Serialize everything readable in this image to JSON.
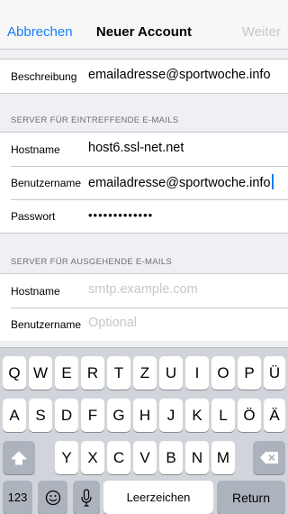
{
  "nav": {
    "cancel": "Abbrechen",
    "title": "Neuer Account",
    "next": "Weiter"
  },
  "account": {
    "description_label": "Beschreibung",
    "description_value": "emailadresse@sportwoche.info"
  },
  "incoming": {
    "header": "SERVER FÜR EINTREFFENDE E-MAILS",
    "hostname_label": "Hostname",
    "hostname_value": "host6.ssl-net.net",
    "username_label": "Benutzername",
    "username_value": "emailadresse@sportwoche.info",
    "password_label": "Passwort",
    "password_value": "•••••••••••••"
  },
  "outgoing": {
    "header": "SERVER FÜR AUSGEHENDE E-MAILS",
    "hostname_label": "Hostname",
    "hostname_placeholder": "smtp.example.com",
    "username_label": "Benutzername",
    "username_placeholder": "Optional"
  },
  "keyboard": {
    "row1": [
      "Q",
      "W",
      "E",
      "R",
      "T",
      "Z",
      "U",
      "I",
      "O",
      "P",
      "Ü"
    ],
    "row2": [
      "A",
      "S",
      "D",
      "F",
      "G",
      "H",
      "J",
      "K",
      "L",
      "Ö",
      "Ä"
    ],
    "row3": [
      "Y",
      "X",
      "C",
      "V",
      "B",
      "N",
      "M"
    ],
    "numbers": "123",
    "space": "Leerzeichen",
    "return": "Return",
    "shift_icon": "shift-arrow",
    "delete_icon": "backspace",
    "emoji_icon": "emoji-face",
    "mic_icon": "microphone"
  },
  "colors": {
    "accent": "#147efb",
    "disabled": "#c7c7cc",
    "background": "#efeff4"
  }
}
